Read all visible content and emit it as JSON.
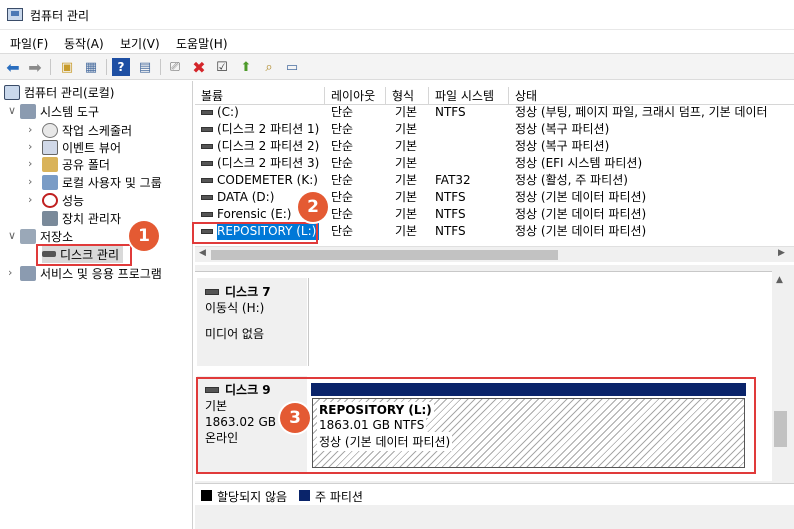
{
  "window": {
    "title": "컴퓨터 관리"
  },
  "menu": [
    "파일(F)",
    "동작(A)",
    "보기(V)",
    "도움말(H)"
  ],
  "toolbar": {
    "buttons": [
      "back-arrow-icon",
      "forward-arrow-icon",
      "up-folder-icon",
      "show-hide-tree-icon",
      "help-icon",
      "properties-icon",
      "connect-icon",
      "delete-icon",
      "check-icon",
      "import-icon",
      "search-icon",
      "export-icon"
    ]
  },
  "tree": {
    "root": "컴퓨터 관리(로컬)",
    "system_tools": "시스템 도구",
    "task_scheduler": "작업 스케줄러",
    "event_viewer": "이벤트 뷰어",
    "shared_folders": "공유 폴더",
    "local_users": "로컬 사용자 및 그룹",
    "performance": "성능",
    "device_manager": "장치 관리자",
    "storage": "저장소",
    "disk_management": "디스크 관리",
    "services": "서비스 및 응용 프로그램"
  },
  "table": {
    "headers": [
      "볼륨",
      "레이아웃",
      "형식",
      "파일 시스템",
      "상태"
    ],
    "rows": [
      {
        "volume": "(C:)",
        "layout": "단순",
        "type": "기본",
        "fs": "NTFS",
        "status": "정상 (부팅, 페이지 파일, 크래시 덤프, 기본 데이터"
      },
      {
        "volume": "(디스크 2 파티션 1)",
        "layout": "단순",
        "type": "기본",
        "fs": "",
        "status": "정상 (복구 파티션)"
      },
      {
        "volume": "(디스크 2 파티션 2)",
        "layout": "단순",
        "type": "기본",
        "fs": "",
        "status": "정상 (복구 파티션)"
      },
      {
        "volume": "(디스크 2 파티션 3)",
        "layout": "단순",
        "type": "기본",
        "fs": "",
        "status": "정상 (EFI 시스템 파티션)"
      },
      {
        "volume": "CODEMETER (K:)",
        "layout": "단순",
        "type": "기본",
        "fs": "FAT32",
        "status": "정상 (활성, 주 파티션)"
      },
      {
        "volume": "DATA (D:)",
        "layout": "단순",
        "type": "기본",
        "fs": "NTFS",
        "status": "정상 (기본 데이터 파티션)"
      },
      {
        "volume": "Forensic (E:)",
        "layout": "단순",
        "type": "기본",
        "fs": "NTFS",
        "status": "정상 (기본 데이터 파티션)"
      },
      {
        "volume": "REPOSITORY (L:)",
        "layout": "단순",
        "type": "기본",
        "fs": "NTFS",
        "status": "정상 (기본 데이터 파티션)"
      }
    ]
  },
  "disks": {
    "disk7": {
      "name": "디스크 7",
      "kind": "이동식 (H:)",
      "media": "미디어 없음"
    },
    "disk9": {
      "name": "디스크 9",
      "kind": "기본",
      "size": "1863.02 GB",
      "state": "온라인",
      "partition": {
        "name": "REPOSITORY  (L:)",
        "size": "1863.01 GB NTFS",
        "status": "정상 (기본 데이터 파티션)"
      }
    }
  },
  "legend": {
    "unallocated": "할당되지 않음",
    "primary": "주 파티션"
  },
  "badges": [
    "1",
    "2",
    "3"
  ],
  "colors": {
    "accent": "#0a246a",
    "highlight": "#e03a3a",
    "badge": "#e45a33",
    "selection": "#0078d7"
  }
}
